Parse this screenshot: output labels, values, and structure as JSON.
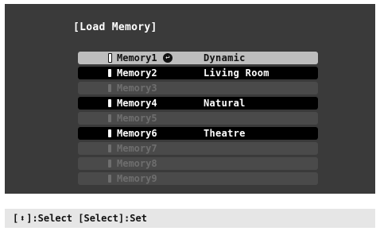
{
  "header": {
    "title": "[Load Memory]"
  },
  "memories": [
    {
      "name": "Memory1",
      "mode": "Dynamic",
      "state": "selected",
      "enter_glyph": "↩"
    },
    {
      "name": "Memory2",
      "mode": "Living Room",
      "state": "filled"
    },
    {
      "name": "Memory3",
      "mode": "",
      "state": "empty"
    },
    {
      "name": "Memory4",
      "mode": "Natural",
      "state": "filled"
    },
    {
      "name": "Memory5",
      "mode": "",
      "state": "empty"
    },
    {
      "name": "Memory6",
      "mode": "Theatre",
      "state": "filled"
    },
    {
      "name": "Memory7",
      "mode": "",
      "state": "empty"
    },
    {
      "name": "Memory8",
      "mode": "",
      "state": "empty"
    },
    {
      "name": "Memory9",
      "mode": "",
      "state": "empty"
    }
  ],
  "footer": {
    "open_bracket": "[",
    "updown_glyph": "⬍",
    "help_rest": "]:Select [Select]:Set"
  }
}
